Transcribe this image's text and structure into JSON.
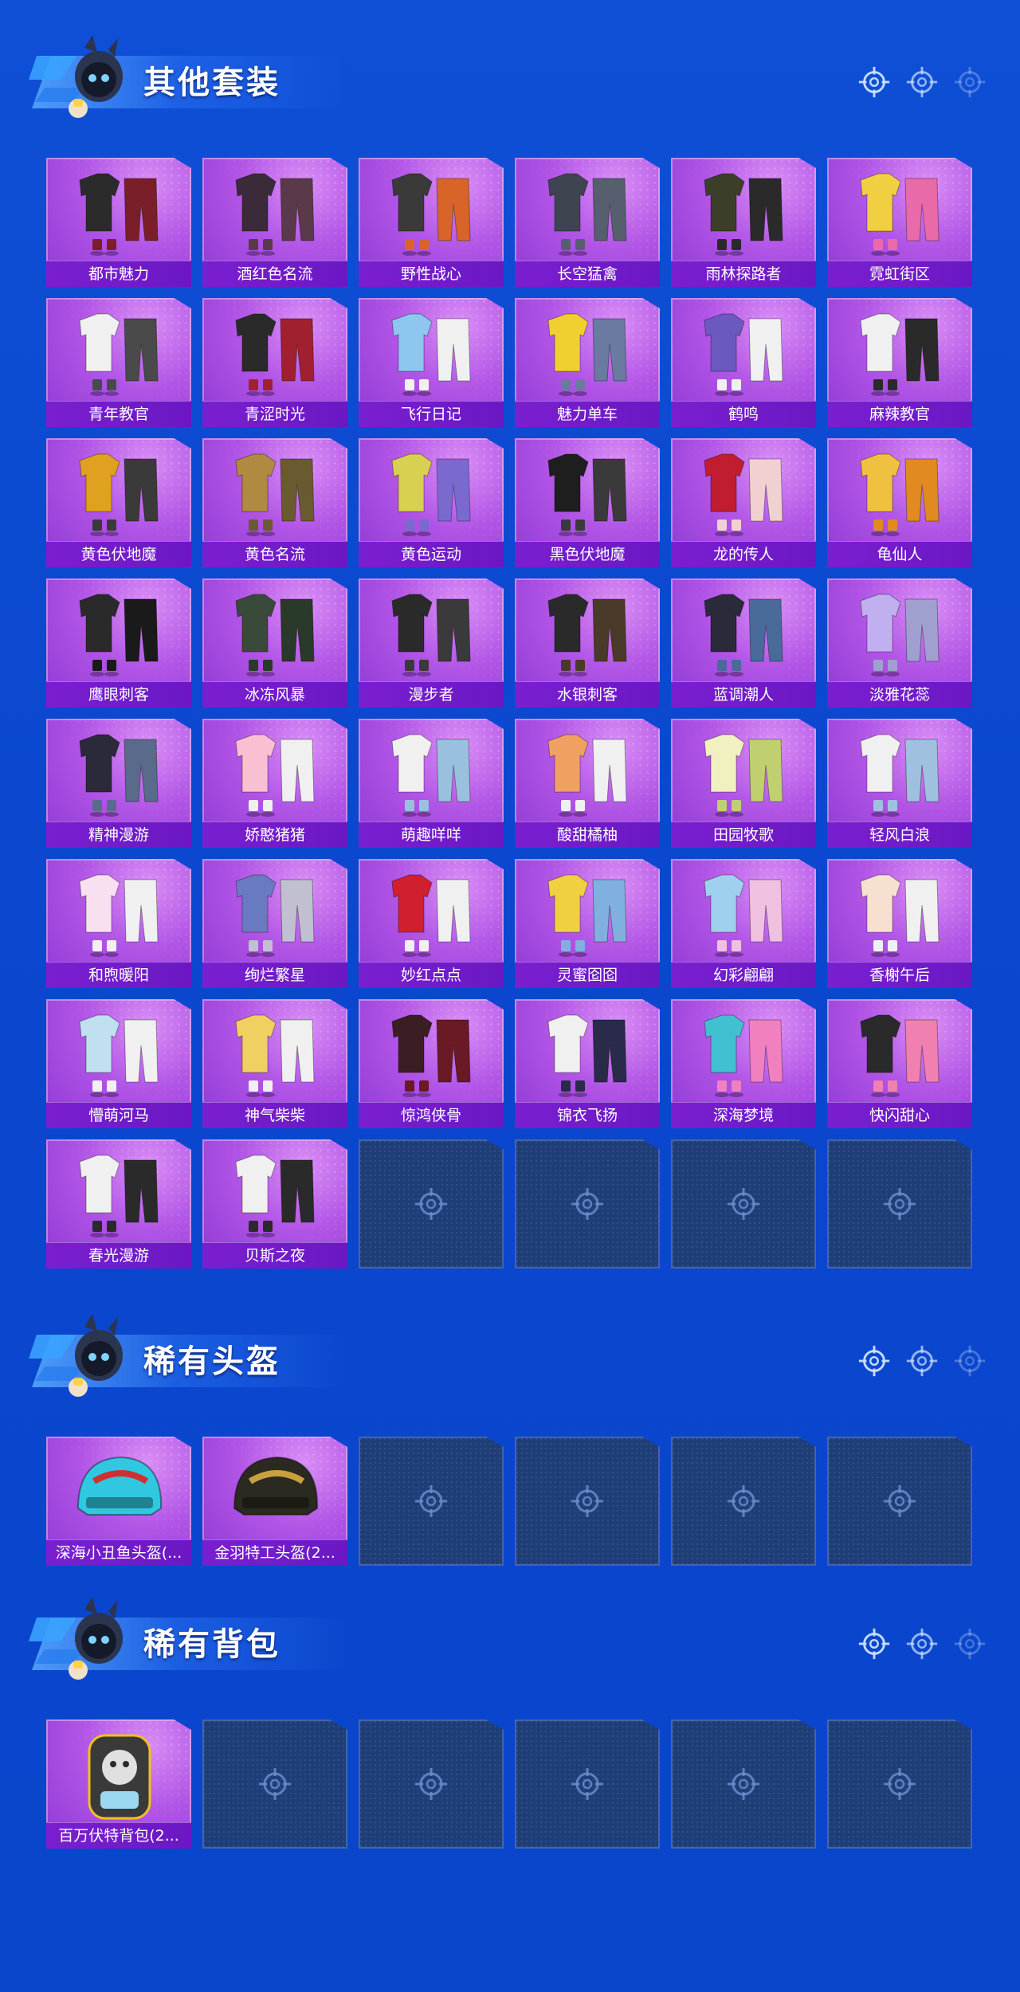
{
  "sections": [
    {
      "title": "其他套装",
      "items": [
        "都市魅力",
        "酒红色名流",
        "野性战心",
        "长空猛禽",
        "雨林探路者",
        "霓虹街区",
        "青年教官",
        "青涩时光",
        "飞行日记",
        "魅力单车",
        "鹤鸣",
        "麻辣教官",
        "黄色伏地魔",
        "黄色名流",
        "黄色运动",
        "黑色伏地魔",
        "龙的传人",
        "龟仙人",
        "鹰眼刺客",
        "冰冻风暴",
        "漫步者",
        "水银刺客",
        "蓝调潮人",
        "淡雅花蕊",
        "精神漫游",
        "娇憨猪猪",
        "萌趣咩咩",
        "酸甜橘柚",
        "田园牧歌",
        "轻风白浪",
        "和煦暖阳",
        "绚烂繁星",
        "妙红点点",
        "灵蜜囵囵",
        "幻彩翩翩",
        "香榭午后",
        "懵萌河马",
        "神气柴柴",
        "惊鸿侠骨",
        "锦衣飞扬",
        "深海梦境",
        "快闪甜心",
        "春光漫游",
        "贝斯之夜"
      ],
      "empty_slots": 4
    },
    {
      "title": "稀有头盔",
      "items": [
        "深海小丑鱼头盔(...",
        "金羽特工头盔(2..."
      ],
      "empty_slots": 4
    },
    {
      "title": "稀有背包",
      "items": [
        "百万伏特背包(2..."
      ],
      "empty_slots": 5
    }
  ],
  "colors": {
    "background": "#0b47cf",
    "tile_purple": "#b155e6",
    "label_purple": "#7a1fd0",
    "empty_slot": "#1f3e78"
  },
  "icons": {
    "header_mascot": "mascot-icon",
    "header_decoration": "crosshair-icon",
    "empty_slot": "crosshair-icon"
  }
}
